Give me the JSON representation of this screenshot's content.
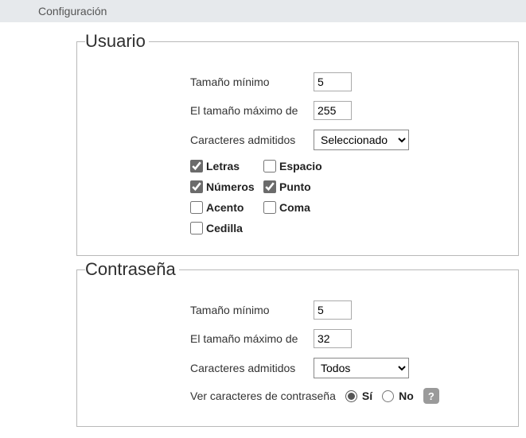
{
  "header": {
    "title": "Configuración"
  },
  "labels": {
    "min_size": "Tamaño mínimo",
    "max_size": "El tamaño máximo de",
    "allowed_chars": "Caracteres admitidos"
  },
  "user": {
    "legend": "Usuario",
    "min_size": "5",
    "max_size": "255",
    "allowed_mode": "Seleccionado",
    "chars": {
      "letras": {
        "label": "Letras",
        "checked": true
      },
      "espacio": {
        "label": "Espacio",
        "checked": false
      },
      "numeros": {
        "label": "Números",
        "checked": true
      },
      "punto": {
        "label": "Punto",
        "checked": true
      },
      "acento": {
        "label": "Acento",
        "checked": false
      },
      "coma": {
        "label": "Coma",
        "checked": false
      },
      "cedilla": {
        "label": "Cedilla",
        "checked": false
      }
    }
  },
  "password": {
    "legend": "Contraseña",
    "min_size": "5",
    "max_size": "32",
    "allowed_mode": "Todos",
    "show_chars": {
      "label": "Ver caracteres de contraseña",
      "yes": "Sí",
      "no": "No",
      "value": "yes"
    },
    "help": "?"
  }
}
